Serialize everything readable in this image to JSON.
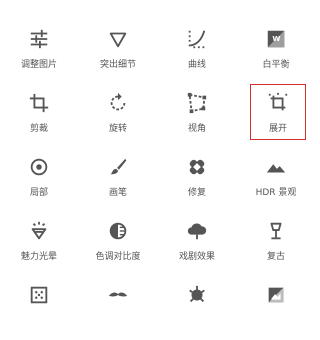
{
  "tools": [
    {
      "label": "调整图片",
      "icon": "tune-icon"
    },
    {
      "label": "突出细节",
      "icon": "details-triangle-icon"
    },
    {
      "label": "曲线",
      "icon": "curves-icon"
    },
    {
      "label": "白平衡",
      "icon": "white-balance-icon"
    },
    {
      "label": "剪裁",
      "icon": "crop-icon"
    },
    {
      "label": "旋转",
      "icon": "rotate-icon"
    },
    {
      "label": "视角",
      "icon": "perspective-icon"
    },
    {
      "label": "展开",
      "icon": "expand-crop-icon",
      "selected": true
    },
    {
      "label": "局部",
      "icon": "selective-target-icon"
    },
    {
      "label": "画笔",
      "icon": "brush-icon"
    },
    {
      "label": "修复",
      "icon": "healing-bandage-icon"
    },
    {
      "label": "HDR 景观",
      "icon": "hdr-mountain-icon"
    },
    {
      "label": "魅力光晕",
      "icon": "glamour-glow-icon"
    },
    {
      "label": "色调对比度",
      "icon": "tonal-contrast-icon"
    },
    {
      "label": "戏剧效果",
      "icon": "drama-cloud-icon"
    },
    {
      "label": "复古",
      "icon": "vintage-lamp-icon"
    },
    {
      "label": "",
      "icon": "grainy-film-icon"
    },
    {
      "label": "",
      "icon": "retrolux-mustache-icon"
    },
    {
      "label": "",
      "icon": "grunge-icon"
    },
    {
      "label": "",
      "icon": "black-white-icon"
    }
  ],
  "colors": {
    "icon": "#555555",
    "label": "#555555",
    "selected_border": "#d32f2f"
  }
}
